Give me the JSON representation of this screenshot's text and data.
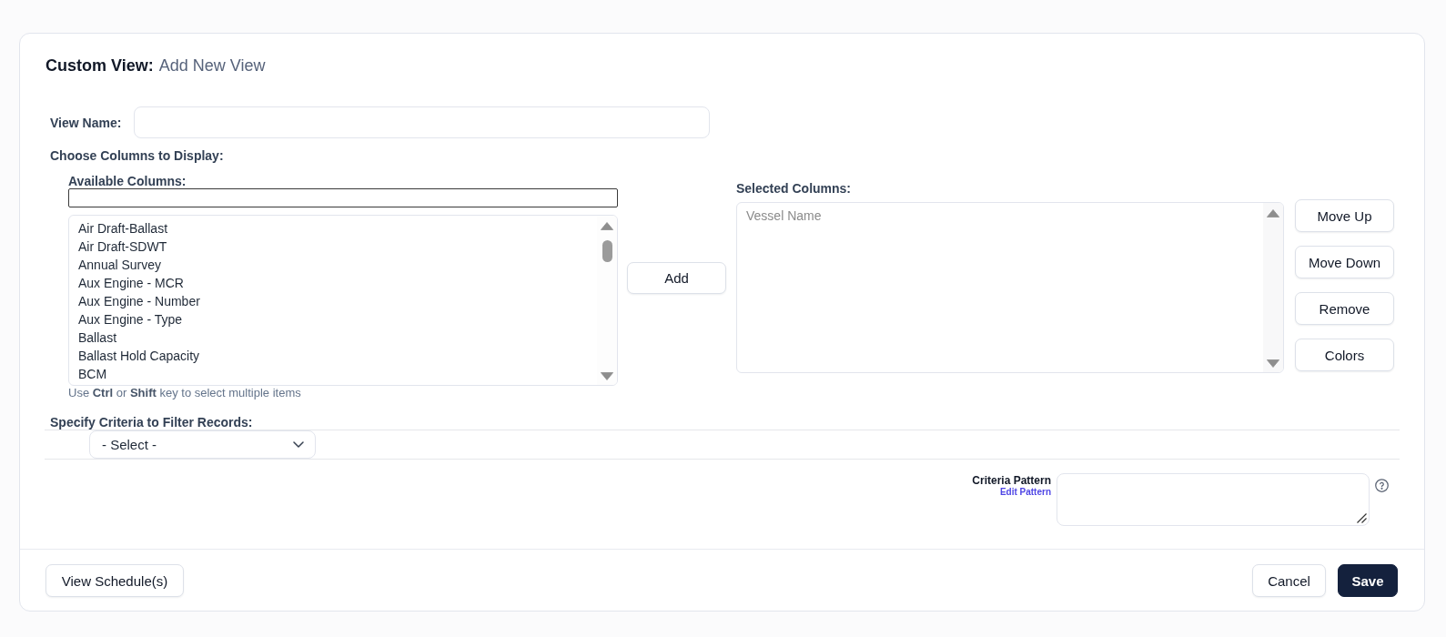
{
  "header": {
    "title": "Custom View:",
    "subtitle": "Add New View"
  },
  "view_name": {
    "label": "View Name:"
  },
  "columns": {
    "heading": "Choose Columns to Display:",
    "available": {
      "label": "Available Columns:",
      "items": [
        {
          "text": "Air Draft-Ballast",
          "selected": false
        },
        {
          "text": "Air Draft-SDWT",
          "selected": false
        },
        {
          "text": "Annual Survey",
          "selected": false
        },
        {
          "text": "Aux Engine - MCR",
          "selected": false
        },
        {
          "text": "Aux Engine - Number",
          "selected": false
        },
        {
          "text": "Aux Engine - Type",
          "selected": false
        },
        {
          "text": "Ballast",
          "selected": false
        },
        {
          "text": "Ballast Hold Capacity",
          "selected": false
        },
        {
          "text": "BCM",
          "selected": false
        }
      ]
    },
    "hint": "Use **Ctrl** or **Shift** key to select multiple items",
    "add_button": "Add",
    "selected": {
      "label": "Selected Columns:",
      "items": [
        {
          "text": "Vessel Name",
          "selected": false,
          "disabled": true
        }
      ]
    },
    "move_up_button": "Move Up",
    "move_down_button": "Move Down",
    "remove_button": "Remove",
    "colors_button": "Colors"
  },
  "filter": {
    "heading": "Specify Criteria to Filter Records:",
    "select": {
      "value": "- Select -"
    }
  },
  "criteria_pattern": {
    "label": "Criteria Pattern",
    "link": "Edit Pattern"
  },
  "footer": {
    "schedule_button": "View Schedule(s)",
    "cancel_button": "Cancel",
    "save_button": "Save"
  }
}
